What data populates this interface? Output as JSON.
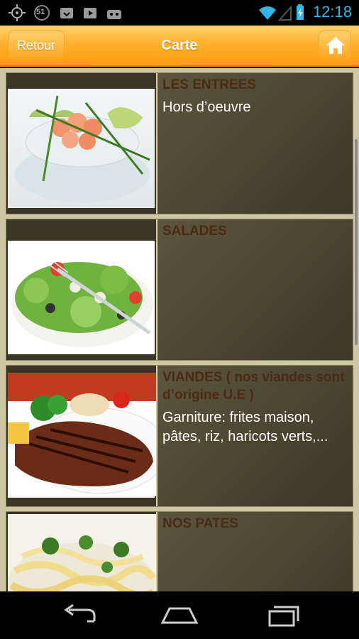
{
  "status_bar": {
    "time": "12:18",
    "notification_badge": "51",
    "icons": [
      "gps-icon",
      "notification-badge-icon",
      "download-icon",
      "video-icon",
      "android-icon",
      "wifi-icon",
      "signal-icon",
      "battery-charging-icon"
    ]
  },
  "header": {
    "back_label": "Retour",
    "title": "Carte",
    "home_icon": "home-icon"
  },
  "menu": [
    {
      "category": "LES ENTREES",
      "description": "Hors d’oeuvre",
      "image": "shrimp-cocktail"
    },
    {
      "category": "SALADES",
      "description": "",
      "image": "salad"
    },
    {
      "category": "VIANDES ( nos viandes sont d’origine U.E )",
      "description": "Garniture: frites maison, pâtes, riz, haricots verts,...",
      "image": "grilled-steak"
    },
    {
      "category": "NOS PATES",
      "description": "",
      "image": "pasta"
    }
  ],
  "nav_bar": {
    "icons": [
      "back-icon",
      "home-nav-icon",
      "recent-apps-icon"
    ]
  },
  "colors": {
    "accent": "#ffa51f",
    "card_bg": "#544d36",
    "category_text": "#4a2a12",
    "status_blue": "#33b5e5"
  }
}
